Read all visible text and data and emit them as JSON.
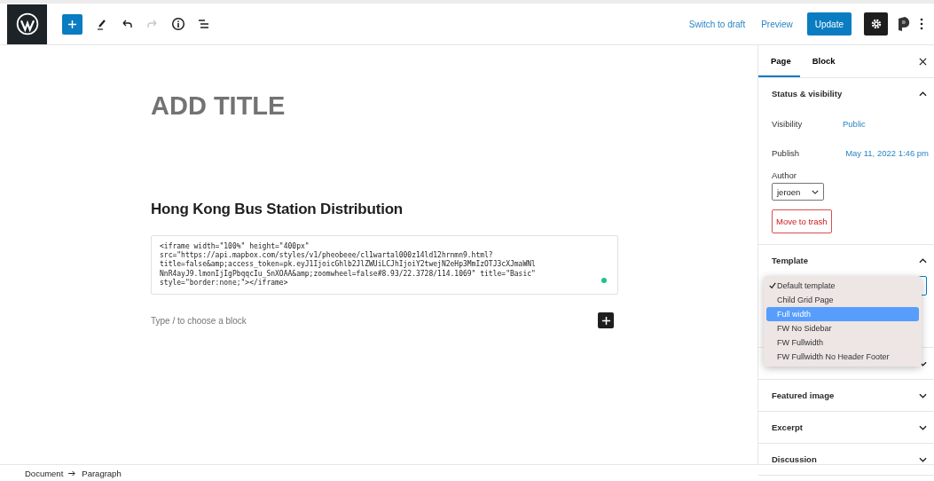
{
  "toolbar": {
    "actions": [
      {
        "label": "Switch to draft",
        "kind": "link"
      },
      {
        "label": "Preview",
        "kind": "link"
      },
      {
        "label": "Update",
        "kind": "primary"
      }
    ],
    "redo_disabled": true
  },
  "editor": {
    "title_placeholder": "ADD TITLE",
    "heading": "Hong Kong Bus Station Distribution",
    "code": "<iframe width=\"100%\" height=\"400px\"\nsrc=\"https://api.mapbox.com/styles/v1/pheobeee/cl1wartal000z14ld12hrnmn9.html?\ntitle=false&amp;access_token=pk.eyJ1IjoicGhlb2JlZWUiLCJhIjoiY2twejN2eHp3MmIzOTJ3cXJmaWNl\nNnR4ayJ9.lmonIjIgPbqqcIu_SnXOAA&amp;zoomwheel=false#8.93/22.3728/114.1069\" title=\"Basic\"\nstyle=\"border:none;\"></iframe>",
    "block_placeholder": "Type / to choose a block"
  },
  "sidebar": {
    "tabs": [
      {
        "label": "Page",
        "selected": true
      },
      {
        "label": "Block",
        "selected": false
      }
    ],
    "status": {
      "title": "Status & visibility",
      "expanded": true,
      "visibility_label": "Visibility",
      "visibility": "Public",
      "publish_label": "Publish",
      "publish": "May 11, 2022 1:46 pm",
      "author_label": "Author",
      "author": "jeroen",
      "trash": "Move to trash"
    },
    "template": {
      "title": "Template",
      "expanded": true,
      "options": [
        {
          "label": "Default template",
          "checked": true,
          "selected": false
        },
        {
          "label": "Child Grid Page",
          "checked": false,
          "selected": false
        },
        {
          "label": "Full width",
          "checked": false,
          "selected": true
        },
        {
          "label": "FW No Sidebar",
          "checked": false,
          "selected": false
        },
        {
          "label": "FW Fullwidth",
          "checked": false,
          "selected": false
        },
        {
          "label": "FW Fullwidth No Header Footer",
          "checked": false,
          "selected": false
        }
      ]
    },
    "sections": [
      {
        "expanded": false
      },
      {
        "title": "Featured image",
        "expanded": false
      },
      {
        "title": "Excerpt",
        "expanded": false
      },
      {
        "title": "Discussion",
        "expanded": false
      }
    ]
  },
  "breadcrumb": [
    "Document",
    "Paragraph"
  ]
}
